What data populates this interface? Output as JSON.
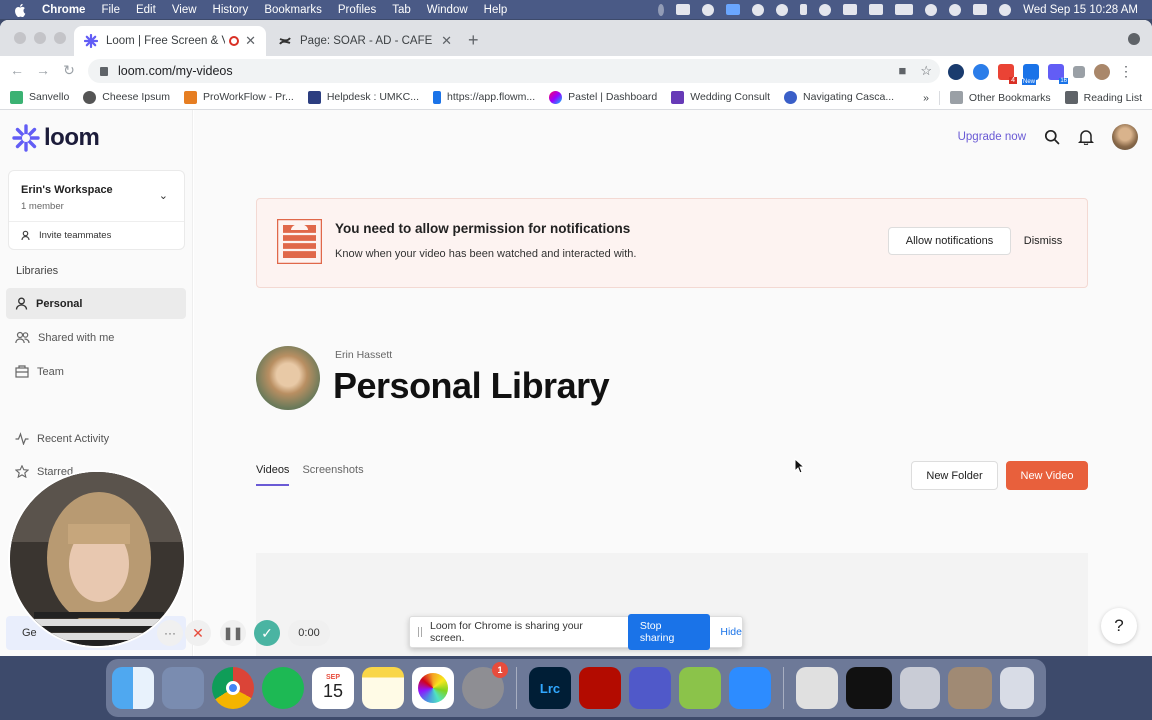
{
  "menubar": {
    "app": "Chrome",
    "items": [
      "File",
      "Edit",
      "View",
      "History",
      "Bookmarks",
      "Profiles",
      "Tab",
      "Window",
      "Help"
    ],
    "clock": "Wed Sep 15  10:28 AM"
  },
  "browser": {
    "tabs": [
      {
        "title": "Loom | Free Screen & Vide",
        "active": true
      },
      {
        "title": "Page: SOAR - AD - CAFE - ww",
        "active": false
      }
    ],
    "url": "loom.com/my-videos",
    "extension_badges": [
      "4",
      "New",
      "16"
    ],
    "bookmarks": [
      "Sanvello",
      "Cheese Ipsum",
      "ProWorkFlow - Pr...",
      "Helpdesk : UMKC...",
      "https://app.flowm...",
      "Pastel | Dashboard",
      "Wedding Consult",
      "Navigating Casca..."
    ],
    "bookmarks_more": "»",
    "other_bookmarks": "Other Bookmarks",
    "reading_list": "Reading List"
  },
  "loom": {
    "logo": "loom",
    "workspace": {
      "name": "Erin's Workspace",
      "members": "1 member",
      "invite": "Invite teammates"
    },
    "libraries_heading": "Libraries",
    "nav": [
      {
        "label": "Personal",
        "active": true
      },
      {
        "label": "Shared with me",
        "active": false
      },
      {
        "label": "Team",
        "active": false
      },
      {
        "label": "Recent Activity",
        "active": false
      },
      {
        "label": "Starred",
        "active": false
      }
    ],
    "sidebar_partial_text": "Ge",
    "upgrade": "Upgrade now",
    "banner": {
      "title": "You need to allow permission for notifications",
      "subtitle": "Know when your video has been watched and interacted with.",
      "allow": "Allow notifications",
      "dismiss": "Dismiss"
    },
    "owner": "Erin Hassett",
    "library_title": "Personal Library",
    "content_tabs": [
      {
        "label": "Videos",
        "active": true
      },
      {
        "label": "Screenshots",
        "active": false
      }
    ],
    "new_folder": "New Folder",
    "new_video": "New Video",
    "help": "?"
  },
  "recorder": {
    "more": "···",
    "timer": "0:00",
    "sharing_text": "Loom for Chrome is sharing your screen.",
    "stop": "Stop sharing",
    "hide": "Hide"
  },
  "dock": {
    "calendar_month": "SEP",
    "calendar_day": "15",
    "settings_badge": "1",
    "lightroom": "Lrc"
  },
  "colors": {
    "accent": "#6a5ad5",
    "new_video": "#e8603c",
    "stop_sharing": "#1a73e8",
    "banner_bg": "#fdf3f1"
  }
}
